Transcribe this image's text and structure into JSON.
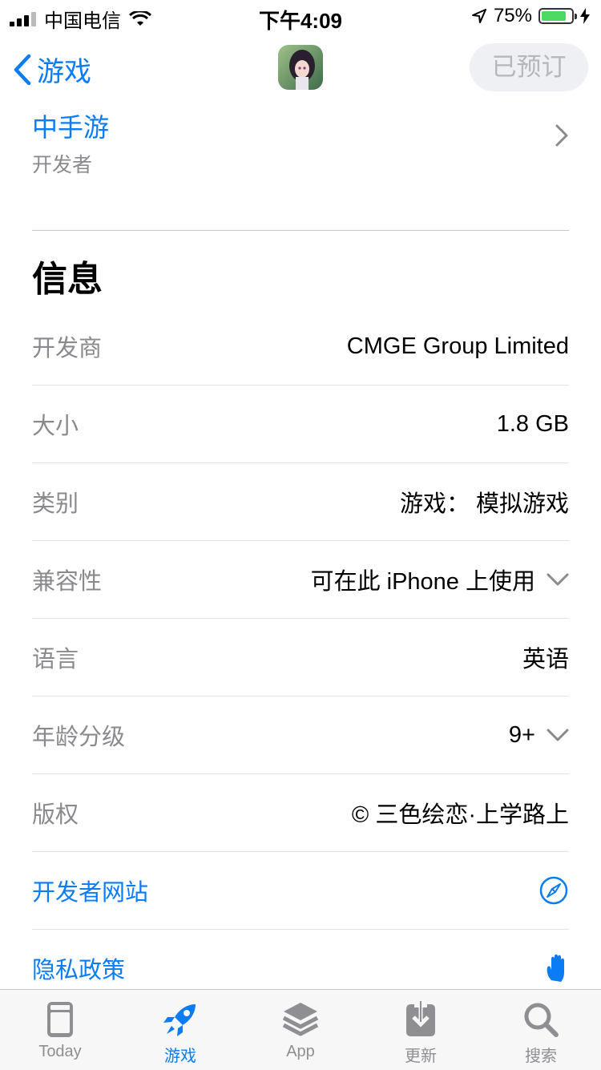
{
  "status_bar": {
    "carrier": "中国电信",
    "time": "下午4:09",
    "battery": "75%",
    "battery_level": 0.75
  },
  "nav": {
    "back_label": "游戏",
    "preorder_label": "已预订"
  },
  "developer": {
    "name": "中手游",
    "subtitle": "开发者"
  },
  "section_title": "信息",
  "info_rows": [
    {
      "label": "开发商",
      "value": "CMGE Group Limited"
    },
    {
      "label": "大小",
      "value": "1.8 GB"
    },
    {
      "label": "类别",
      "value": "游戏： 模拟游戏"
    },
    {
      "label": "兼容性",
      "value": "可在此 iPhone 上使用"
    },
    {
      "label": "语言",
      "value": "英语"
    },
    {
      "label": "年龄分级",
      "value": "9+"
    },
    {
      "label": "版权",
      "value": "© 三色绘恋·上学路上"
    }
  ],
  "links": [
    {
      "label": "开发者网站",
      "icon": "compass-icon"
    },
    {
      "label": "隐私政策",
      "icon": "hand-icon"
    }
  ],
  "tabs": [
    {
      "label": "Today",
      "icon": "today-icon"
    },
    {
      "label": "游戏",
      "icon": "rocket-icon",
      "active": true
    },
    {
      "label": "App",
      "icon": "layers-icon"
    },
    {
      "label": "更新",
      "icon": "download-icon"
    },
    {
      "label": "搜索",
      "icon": "search-icon"
    }
  ],
  "colors": {
    "accent": "#0a7cf5",
    "secondary_text": "#8a8a8e",
    "battery": "#4cd964"
  }
}
